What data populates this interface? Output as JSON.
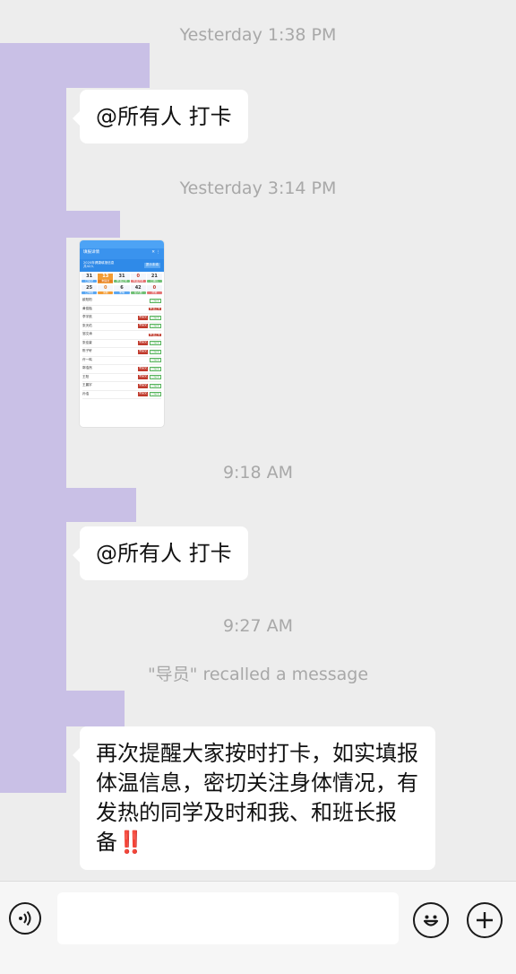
{
  "chat": {
    "messages": [
      {
        "type": "timestamp",
        "text": "Yesterday 1:38 PM"
      },
      {
        "type": "text",
        "text": "@所有人 打卡"
      },
      {
        "type": "timestamp",
        "text": "Yesterday 3:14 PM"
      },
      {
        "type": "image"
      },
      {
        "type": "timestamp",
        "text": "9:18 AM"
      },
      {
        "type": "text",
        "text": "@所有人 打卡"
      },
      {
        "type": "timestamp",
        "text": "9:27 AM"
      },
      {
        "type": "system",
        "text": "\"导员\" recalled a message"
      },
      {
        "type": "text",
        "text": "再次提醒大家按时打卡，如实填报体温信息，密切关注身体情况，有发热的同学及时和我、和班长报备",
        "trailing": "‼️"
      }
    ]
  },
  "screenshot_thumb": {
    "bar_title": "填报详情",
    "banner_text": "2020年健康填报信息",
    "banner_sub": "共42人",
    "banner_button": "提示未填",
    "stats_top": [
      {
        "num": "31",
        "label": "已提交"
      },
      {
        "num": "13",
        "label": "未提交"
      },
      {
        "num": "31",
        "label": "体温正常"
      },
      {
        "num": "0",
        "label": "体温异常"
      },
      {
        "num": "21",
        "label": "已确认"
      }
    ],
    "stats_bottom": [
      {
        "num": "25",
        "label": "已填报"
      },
      {
        "num": "0",
        "label": "请假"
      },
      {
        "num": "6",
        "label": "未填"
      },
      {
        "num": "42",
        "label": "总人数"
      },
      {
        "num": "0",
        "label": "异常"
      }
    ],
    "rows": [
      {
        "name": "欧阳阳",
        "tags": [
          "已提交"
        ]
      },
      {
        "name": "黄俊楷",
        "tags": [
          "体温正常"
        ]
      },
      {
        "name": "李宇航",
        "tags": [
          "未提交",
          "已提交"
        ]
      },
      {
        "name": "张天佑",
        "tags": [
          "未提交",
          "已提交"
        ]
      },
      {
        "name": "邹文涛",
        "tags": [
          "体温正常"
        ]
      },
      {
        "name": "张佳豪",
        "tags": [
          "未提交",
          "已提交"
        ]
      },
      {
        "name": "陈子轩",
        "tags": [
          "未提交",
          "已提交"
        ]
      },
      {
        "name": "许一鸣",
        "tags": [
          "已提交"
        ]
      },
      {
        "name": "郭浩然",
        "tags": [
          "未提交",
          "已提交"
        ]
      },
      {
        "name": "王阳",
        "tags": [
          "未提交",
          "已提交"
        ]
      },
      {
        "name": "王晨宇",
        "tags": [
          "未提交",
          "已提交"
        ]
      },
      {
        "name": "孙浩",
        "tags": [
          "未提交",
          "已提交"
        ]
      }
    ]
  },
  "input_bar": {
    "voice_icon": "voice-icon",
    "emoji_icon": "emoji-icon",
    "plus_icon": "plus-icon",
    "placeholder": ""
  }
}
